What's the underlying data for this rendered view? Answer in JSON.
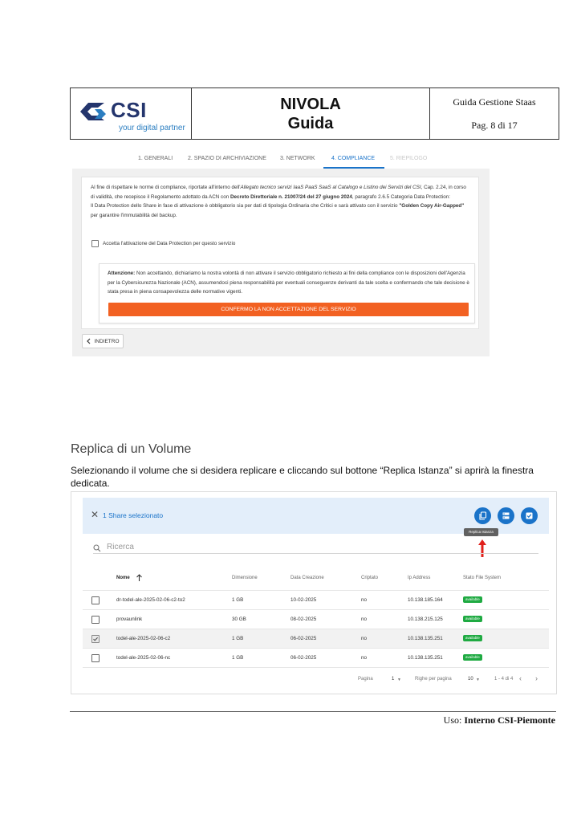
{
  "header": {
    "logo_text": "CSI",
    "logo_subtitle": "your digital partner",
    "title_line1": "NIVOLA",
    "title_line2": "Guida",
    "doc_name": "Guida Gestione Staas",
    "page": "Pag. 8 di 17"
  },
  "wizard": {
    "steps": [
      {
        "label": "1. GENERALI",
        "state": "done"
      },
      {
        "label": "2. SPAZIO DI ARCHIVIAZIONE",
        "state": "done"
      },
      {
        "label": "3. NETWORK",
        "state": "done"
      },
      {
        "label": "4. COMPLIANCE",
        "state": "active"
      },
      {
        "label": "5. RIEPILOGO",
        "state": "disabled"
      }
    ],
    "intro_1": "Al fine di rispettare le norme di compliance, riportate all'interno dell'",
    "intro_2": "Allegato tecnico servizi IaaS PaaS SaaS al Catalogo e Listino dei Servizi del CSI",
    "intro_3": ", Cap. 2.24, in corso di validità, che recepisce il Regolamento adottato da ACN con ",
    "intro_4": "Decreto Direttoriale n. 21007/24 del 27 giugno 2024",
    "intro_5": ", paragrafo 2.6.5 Categoria Data Protection:",
    "intro_6": "Il Data Protection dello Share in fase di attivazione è obbligatorio sia per dati di tipologia Ordinaria che Critici e sarà attivato con il servizio ",
    "intro_7": "\"Golden Copy Air-Gapped\"",
    "intro_8": " per garantire l'immutabilità del backup.",
    "checkbox_label": "Accetta l'attivazione del Data Protection per questo servizio",
    "warning_label": "Attenzione:",
    "warning_text": " Non accettando, dichiariamo la nostra volontà di non attivare il servizio obbligatorio richiesto ai fini della compliance con le disposizioni dell'Agenzia per la Cybersicurezza Nazionale (ACN), assumendoci piena responsabilità per eventuali conseguenze derivanti da tale scelta e confermando che tale decisione è stata presa in piena consapevolezza delle normative vigenti.",
    "confirm_button": "CONFERMO LA NON ACCETTAZIONE DEL SERVIZIO",
    "back_button": "INDIETRO"
  },
  "section": {
    "title": "Replica di un Volume",
    "body": "Selezionando il volume che si desidera replicare e cliccando sul bottone “Replica Istanza” si aprirà la finestra dedicata."
  },
  "table": {
    "selection_text": "1 Share selezionato",
    "tooltip": "Replica Istanza",
    "search_placeholder": "Ricerca",
    "columns": [
      "Nome",
      "Dimensione",
      "Data Creazione",
      "Criptato",
      "Ip Address",
      "Stato File System"
    ],
    "rows": [
      {
        "name": "dr-todel-ale-2025-02-06-c2-to2",
        "size": "1 GB",
        "date": "10-02-2025",
        "encrypted": "no",
        "ip": "10.138.185.164",
        "status": "available",
        "selected": false
      },
      {
        "name": "provaunlink",
        "size": "30 GB",
        "date": "08-02-2025",
        "encrypted": "no",
        "ip": "10.138.215.125",
        "status": "available",
        "selected": false
      },
      {
        "name": "todel-ale-2025-02-06-c2",
        "size": "1 GB",
        "date": "06-02-2025",
        "encrypted": "no",
        "ip": "10.138.135.251",
        "status": "available",
        "selected": true
      },
      {
        "name": "todel-ale-2025-02-06-nc",
        "size": "1 GB",
        "date": "06-02-2025",
        "encrypted": "no",
        "ip": "10.138.135.251",
        "status": "available",
        "selected": false
      }
    ],
    "pager": {
      "page_label": "Pagina",
      "page_value": "1",
      "rows_label": "Righe per pagina",
      "rows_value": "10",
      "range": "1 - 4 di 4"
    }
  },
  "footer": {
    "prefix": "Uso: ",
    "value": "Interno CSI-Piemonte"
  },
  "colors": {
    "accent": "#1a73c9",
    "danger_button": "#f26122",
    "status_available": "#1faa42",
    "selection_bar": "#e3eefa",
    "arrow": "#e0201b"
  }
}
